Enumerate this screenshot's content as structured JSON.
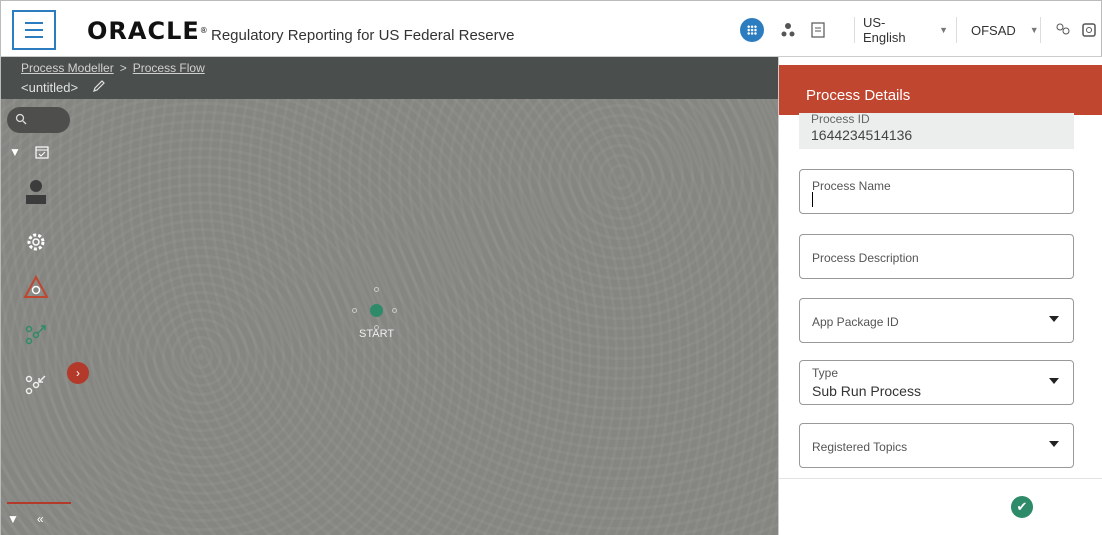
{
  "header": {
    "brand": "ORACLE",
    "brand_mark": "®",
    "app_title": "Regulatory Reporting for US Federal Reserve",
    "language": "US-English",
    "user": "OFSAD",
    "icons": [
      "menu-icon",
      "apps-icon",
      "user-hierarchy-icon",
      "document-icon",
      "users-icon",
      "screen-icon"
    ]
  },
  "breadcrumb": {
    "items": [
      "Process Modeller",
      "Process Flow"
    ],
    "separator": ">",
    "doc_name": "<untitled>"
  },
  "palette": {
    "search_icon": "search-icon",
    "icons": [
      "calendar-icon",
      "person-icon",
      "gear-icon",
      "warning-gear-icon",
      "flow-split-icon",
      "flow-merge-icon"
    ]
  },
  "canvas": {
    "start_label": "START"
  },
  "panel": {
    "title": "Process Details",
    "process_id_label": "Process ID",
    "process_id_value": "1644234514136",
    "process_name_label": "Process Name",
    "process_name_value": "",
    "process_description_label": "Process Description",
    "app_package_label": "App Package ID",
    "type_label": "Type",
    "type_value": "Sub Run Process",
    "registered_topics_label": "Registered Topics"
  },
  "colors": {
    "accent": "#2c7dc0",
    "panel_header": "#c0462f",
    "start_node": "#2e8b6a",
    "canvas": "#858681"
  }
}
